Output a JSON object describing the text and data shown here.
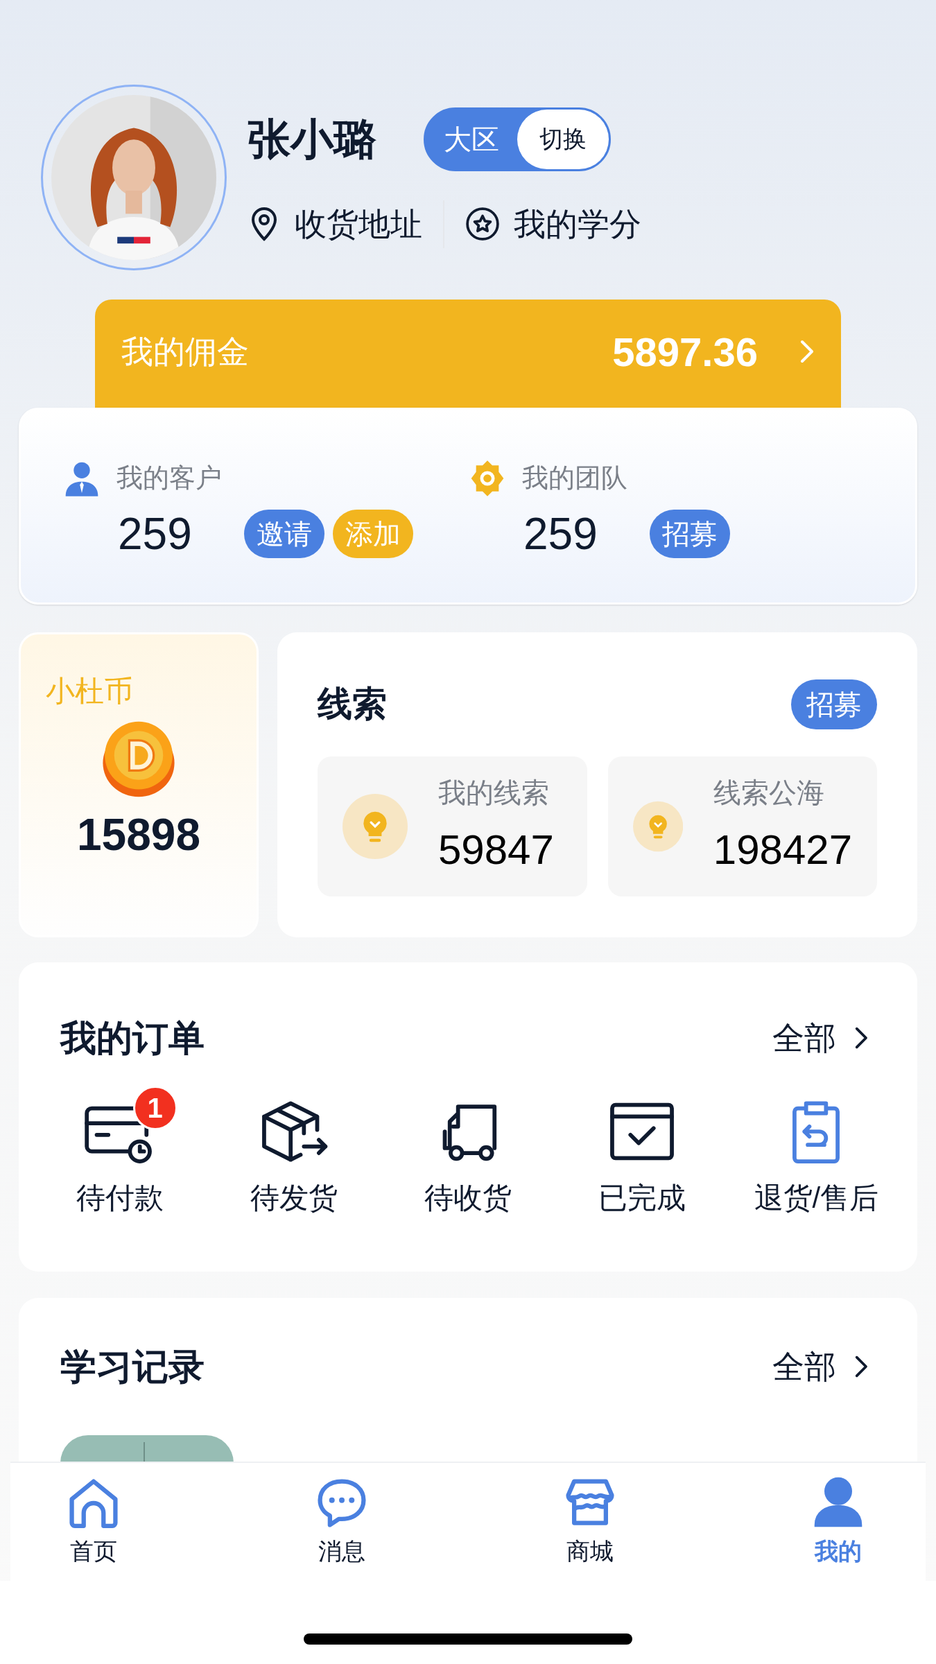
{
  "profile": {
    "name": "张小璐",
    "region_label": "大区",
    "switch_label": "切换",
    "links": [
      {
        "kind": "location",
        "label": "收货地址"
      },
      {
        "kind": "star",
        "label": "我的学分"
      }
    ]
  },
  "commission": {
    "label": "我的佣金",
    "amount": "5897.36"
  },
  "stats": [
    {
      "kind": "person",
      "label": "我的客户",
      "value": "259",
      "actions": [
        {
          "label": "邀请",
          "color": "#4a80e0"
        },
        {
          "label": "添加",
          "color": "#f2b51f"
        }
      ]
    },
    {
      "kind": "gear",
      "label": "我的团队",
      "value": "259",
      "actions": [
        {
          "label": "招募",
          "color": "#4a80e0"
        }
      ]
    }
  ],
  "coins": {
    "title": "小杜币",
    "value": "15898"
  },
  "clues": {
    "title": "线索",
    "action": "招募",
    "items": [
      {
        "label": "我的线索",
        "value": "59847"
      },
      {
        "label": "线索公海",
        "value": "198427"
      }
    ]
  },
  "orders": {
    "title": "我的订单",
    "more": "全部",
    "items": [
      {
        "kind": "payment",
        "label": "待付款",
        "badge": "1"
      },
      {
        "kind": "box",
        "label": "待发货"
      },
      {
        "kind": "truck",
        "label": "待收货"
      },
      {
        "kind": "done",
        "label": "已完成"
      },
      {
        "kind": "return",
        "label": "退货/售后"
      }
    ]
  },
  "learning": {
    "title": "学习记录",
    "more": "全部"
  },
  "tabbar": [
    {
      "kind": "home",
      "label": "首页",
      "selected": false
    },
    {
      "kind": "message",
      "label": "消息",
      "selected": false
    },
    {
      "kind": "store",
      "label": "商城",
      "selected": false
    },
    {
      "kind": "me",
      "label": "我的",
      "selected": true
    }
  ]
}
